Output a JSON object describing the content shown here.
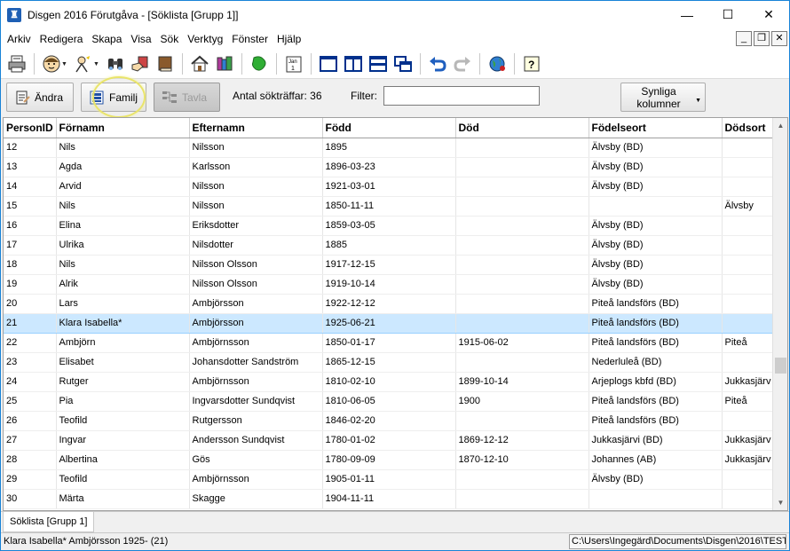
{
  "window": {
    "title": "Disgen 2016 Förutgåva - [Söklista [Grupp 1]]",
    "minimize": "—",
    "maximize": "☐",
    "close": "✕"
  },
  "menu": {
    "items": [
      "Arkiv",
      "Redigera",
      "Skapa",
      "Visa",
      "Sök",
      "Verktyg",
      "Fönster",
      "Hjälp"
    ],
    "mdi_minimize": "_",
    "mdi_restore": "❐",
    "mdi_close": "✕"
  },
  "toolbar": {
    "icons": [
      "print-icon",
      "person-icon",
      "person-search-icon",
      "binoculars-icon",
      "hand-book-icon",
      "book-icon",
      "home-icon",
      "books-icon",
      "map-icon",
      "calendar-icon",
      "layout-single-icon",
      "layout-two-columns-icon",
      "layout-rows-icon",
      "layout-cascade-icon",
      "undo-icon",
      "redo-icon",
      "web-icon",
      "help-icon"
    ],
    "calendar_text": "Jan"
  },
  "search": {
    "edit_label": "Ändra",
    "family_label": "Familj",
    "board_label": "Tavla",
    "hit_count_label": "Antal sökträffar: 36",
    "filter_label": "Filter:",
    "filter_value": "",
    "columns_label_1": "Synliga",
    "columns_label_2": "kolumner"
  },
  "grid": {
    "columns": [
      "PersonID",
      "Förnamn",
      "Efternamn",
      "Född",
      "Död",
      "Födelseort",
      "Dödsort"
    ],
    "selected_index": 9,
    "rows": [
      [
        "12",
        "Nils",
        "Nilsson",
        "1895",
        "",
        "Älvsby (BD)",
        ""
      ],
      [
        "13",
        "Agda",
        "Karlsson",
        "1896-03-23",
        "",
        "Älvsby (BD)",
        ""
      ],
      [
        "14",
        "Arvid",
        "Nilsson",
        "1921-03-01",
        "",
        "Älvsby (BD)",
        ""
      ],
      [
        "15",
        "Nils",
        "Nilsson",
        "1850-11-11",
        "",
        "",
        "Älvsby"
      ],
      [
        "16",
        "Elina",
        "Eriksdotter",
        "1859-03-05",
        "",
        "Älvsby (BD)",
        ""
      ],
      [
        "17",
        "Ulrika",
        "Nilsdotter",
        "1885",
        "",
        "Älvsby (BD)",
        ""
      ],
      [
        "18",
        "Nils",
        "Nilsson Olsson",
        "1917-12-15",
        "",
        "Älvsby (BD)",
        ""
      ],
      [
        "19",
        "Alrik",
        "Nilsson Olsson",
        "1919-10-14",
        "",
        "Älvsby (BD)",
        ""
      ],
      [
        "20",
        "Lars",
        "Ambjörsson",
        "1922-12-12",
        "",
        "Piteå landsförs (BD)",
        ""
      ],
      [
        "21",
        "Klara Isabella*",
        "Ambjörsson",
        "1925-06-21",
        "",
        "Piteå landsförs (BD)",
        ""
      ],
      [
        "22",
        "Ambjörn",
        "Ambjörnsson",
        "1850-01-17",
        "1915-06-02",
        "Piteå landsförs (BD)",
        "Piteå"
      ],
      [
        "23",
        "Elisabet",
        "Johansdotter Sandström",
        "1865-12-15",
        "",
        "Nederluleå (BD)",
        ""
      ],
      [
        "24",
        "Rutger",
        "Ambjörnsson",
        "1810-02-10",
        "1899-10-14",
        "Arjeplogs kbfd (BD)",
        "Jukkasjärv"
      ],
      [
        "25",
        "Pia",
        "Ingvarsdotter Sundqvist",
        "1810-06-05",
        "1900",
        "Piteå landsförs (BD)",
        "Piteå"
      ],
      [
        "26",
        "Teofild",
        "Rutgersson",
        "1846-02-20",
        "",
        "Piteå landsförs (BD)",
        ""
      ],
      [
        "27",
        "Ingvar",
        "Andersson Sundqvist",
        "1780-01-02",
        "1869-12-12",
        "Jukkasjärvi (BD)",
        "Jukkasjärv"
      ],
      [
        "28",
        "Albertina",
        "Gös",
        "1780-09-09",
        "1870-12-10",
        "Johannes (AB)",
        "Jukkasjärv"
      ],
      [
        "29",
        "Teofild",
        "Ambjörnsson",
        "1905-01-11",
        "",
        "Älvsby (BD)",
        ""
      ],
      [
        "30",
        "Märta",
        "Skagge",
        "1904-11-11",
        "",
        "",
        ""
      ]
    ]
  },
  "tabs": {
    "active": "Söklista [Grupp 1]"
  },
  "status": {
    "left": "Klara Isabella* Ambjörsson 1925- (21)",
    "right": "C:\\Users\\Ingegärd\\Documents\\Disgen\\2016\\TEST"
  },
  "colors": {
    "selection": "#cce8ff",
    "accent": "#1883d7"
  }
}
